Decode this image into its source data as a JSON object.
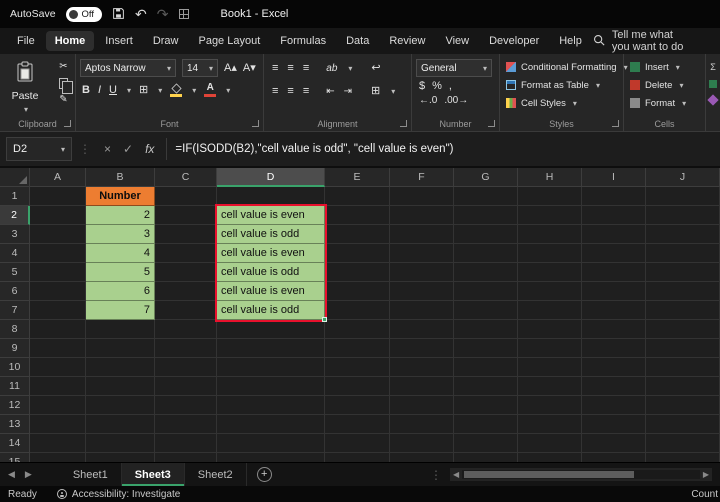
{
  "titlebar": {
    "autosave_label": "AutoSave",
    "autosave_state": "Off",
    "title": "Book1 - Excel"
  },
  "menu": {
    "items": [
      "File",
      "Home",
      "Insert",
      "Draw",
      "Page Layout",
      "Formulas",
      "Data",
      "Review",
      "View",
      "Developer",
      "Help"
    ],
    "active": "Home",
    "search_text": "Tell me what you want to do"
  },
  "ribbon": {
    "paste_label": "Paste",
    "clipboard_group": "Clipboard",
    "font_name": "Aptos Narrow",
    "font_size": "14",
    "font_group": "Font",
    "alignment_group": "Alignment",
    "number_format": "General",
    "number_group": "Number",
    "conditional_formatting": "Conditional Formatting",
    "format_as_table": "Format as Table",
    "cell_styles": "Cell Styles",
    "styles_group": "Styles",
    "insert": "Insert",
    "delete": "Delete",
    "format": "Format",
    "cells_group": "Cells"
  },
  "formula_bar": {
    "name_box": "D2",
    "formula": "=IF(ISODD(B2),\"cell value is odd\", \"cell value is even\")"
  },
  "grid": {
    "column_headers": [
      "A",
      "B",
      "C",
      "D",
      "E",
      "F",
      "G",
      "H",
      "I",
      "J"
    ],
    "row_headers": [
      "1",
      "2",
      "3",
      "4",
      "5",
      "6",
      "7",
      "8",
      "9",
      "10",
      "11",
      "12",
      "13",
      "14",
      "15"
    ],
    "selected_column": "D",
    "selected_row": "2",
    "cells": {
      "B1": {
        "v": "Number",
        "cls": "c-orange"
      },
      "B2": {
        "v": "2",
        "cls": "c-green num"
      },
      "B3": {
        "v": "3",
        "cls": "c-green num"
      },
      "B4": {
        "v": "4",
        "cls": "c-green num"
      },
      "B5": {
        "v": "5",
        "cls": "c-green num"
      },
      "B6": {
        "v": "6",
        "cls": "c-green num"
      },
      "B7": {
        "v": "7",
        "cls": "c-green num"
      },
      "D2": {
        "v": "cell value is even",
        "cls": "c-green txt"
      },
      "D3": {
        "v": "cell value is odd",
        "cls": "c-green txt"
      },
      "D4": {
        "v": "cell value is even",
        "cls": "c-green txt"
      },
      "D5": {
        "v": "cell value is odd",
        "cls": "c-green txt"
      },
      "D6": {
        "v": "cell value is even",
        "cls": "c-green txt"
      },
      "D7": {
        "v": "cell value is odd",
        "cls": "c-green txt"
      }
    }
  },
  "sheet_tabs": {
    "tabs": [
      "Sheet1",
      "Sheet3",
      "Sheet2"
    ],
    "active": "Sheet3"
  },
  "status_bar": {
    "mode": "Ready",
    "accessibility": "Accessibility: Investigate",
    "count": "Count"
  },
  "icons": {
    "undo": "↶",
    "redo": "↷",
    "dropdown": "▾",
    "cut": "✂",
    "painter": "✎",
    "bold": "B",
    "italic": "I",
    "underline": "U",
    "grow_font": "A▴",
    "shrink_font": "A▾",
    "borders": "⊞",
    "align": "≡",
    "orient": "ab",
    "wrap": "↩",
    "merge": "⊞",
    "currency": "$",
    "percent": "%",
    "comma": ",",
    "dec_inc": "←.0",
    "dec_dec": ".00→",
    "sigma": "Σ",
    "close": "×",
    "check": "✓",
    "fx": "fx",
    "dots": "⋮",
    "left": "◀",
    "right": "▶",
    "plus": "+"
  },
  "colors": {
    "accent_green": "#3aa36b",
    "fill_green": "#a9d08e",
    "fill_orange": "#ed7d31",
    "highlight_red": "#e8112d"
  }
}
